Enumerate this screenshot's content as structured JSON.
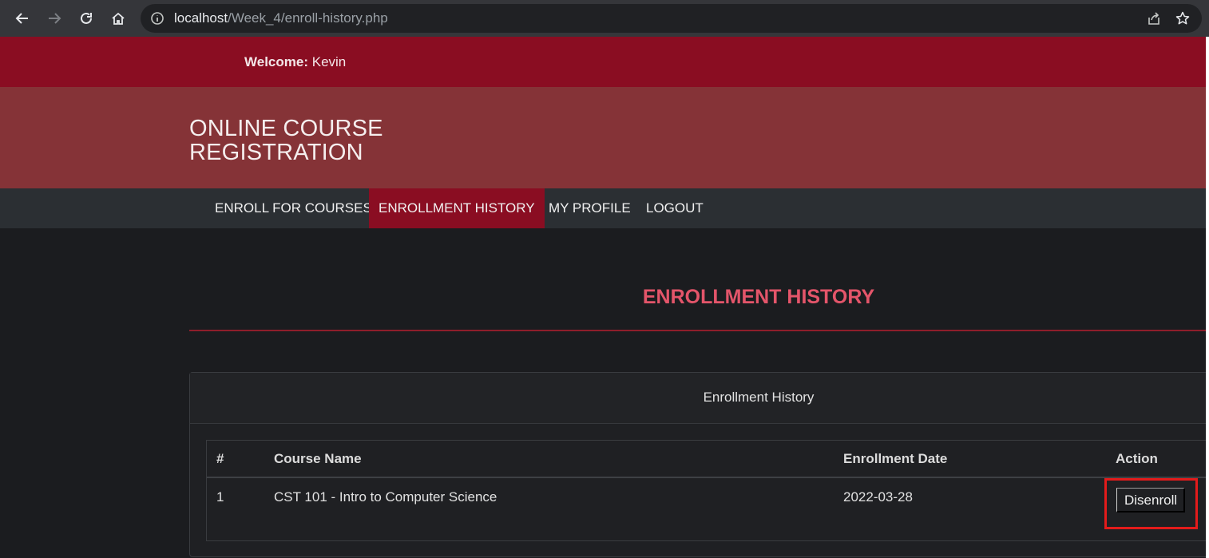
{
  "browser": {
    "url_host": "localhost",
    "url_path": "/Week_4/enroll-history.php"
  },
  "header": {
    "welcome_label": "Welcome:",
    "welcome_user": "Kevin",
    "brand": "ONLINE COURSE REGISTRATION"
  },
  "menu": {
    "items": [
      {
        "label": "ENROLL FOR COURSES"
      },
      {
        "label": "ENROLLMENT HISTORY",
        "active": true
      },
      {
        "label": "MY PROFILE"
      },
      {
        "label": "LOGOUT"
      }
    ]
  },
  "main": {
    "heading": "ENROLLMENT HISTORY",
    "panel_title": "Enrollment History",
    "table": {
      "columns": [
        "#",
        "Course Name",
        "Enrollment Date",
        "Action"
      ],
      "rows": [
        {
          "num": "1",
          "course": "CST 101 - Intro to Computer Science",
          "date": "2022-03-28",
          "action": "Disenroll"
        }
      ]
    }
  },
  "colors": {
    "welcome_bar": "#8a0d22",
    "brand_bar": "#853337",
    "menu_bar": "#2b2f33",
    "active_menu": "#8a0d22",
    "heading": "#e4556a",
    "page_background": "#1b1c1f",
    "highlight_box": "#e31b1b"
  }
}
